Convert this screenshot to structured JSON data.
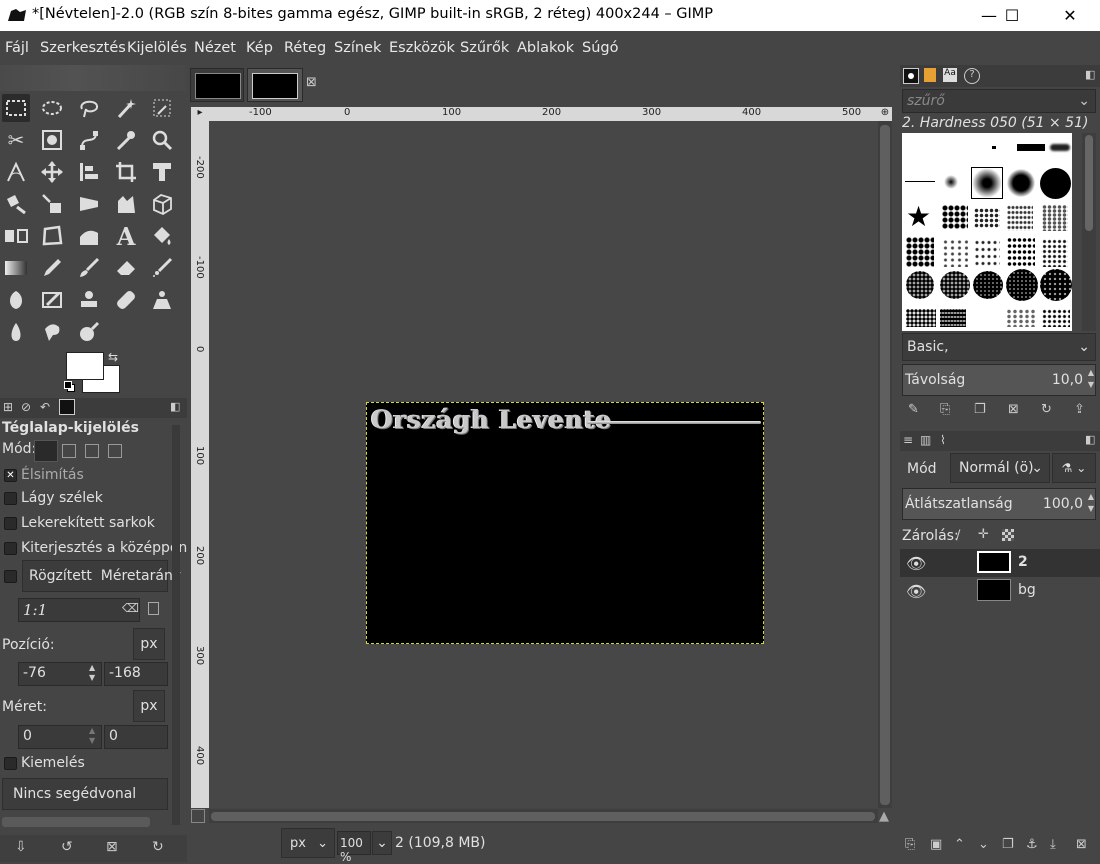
{
  "window": {
    "title": "*[Névtelen]-2.0 (RGB szín 8-bites gamma egész, GIMP built-in sRGB, 2 réteg) 400x244 – GIMP",
    "minimize": "—",
    "maximize": "☐",
    "close": "✕"
  },
  "menu": [
    "Fájl",
    "Szerkesztés",
    "Kijelölés",
    "Nézet",
    "Kép",
    "Réteg",
    "Színek",
    "Eszközök",
    "Szűrők",
    "Ablakok",
    "Súgó"
  ],
  "tool_options": {
    "title": "Téglalap-kijelölés",
    "mode_label": "Mód:",
    "antialias": "Élsimítás",
    "feather": "Lágy szélek",
    "rounded": "Lekerekített sarkok",
    "expand_center": "Kiterjesztés a középpont",
    "fixed_label": "Rögzített",
    "fixed_option": "Méretarány",
    "ratio_value": "1:1",
    "position_label": "Pozíció:",
    "position_unit": "px",
    "pos_x": "-76",
    "pos_y": "-168",
    "size_label": "Méret:",
    "size_unit": "px",
    "size_w": "0",
    "size_h": "0",
    "highlight": "Kiemelés",
    "guides": "Nincs segédvonal"
  },
  "ruler": {
    "h_ticks": [
      "-100",
      "0",
      "100",
      "200",
      "300",
      "400",
      "500"
    ],
    "v_ticks": [
      "-200",
      "-100",
      "0",
      "100",
      "200",
      "300",
      "400"
    ]
  },
  "canvas": {
    "text": "Országh Levente"
  },
  "status": {
    "unit": "px",
    "zoom": "100 %",
    "info": "2 (109,8 MB)"
  },
  "brushes": {
    "filter_placeholder": "szűrő",
    "current": "2. Hardness 050 (51 × 51)",
    "tag": "Basic,",
    "spacing_label": "Távolság",
    "spacing_value": "10,0"
  },
  "layers": {
    "mode_label": "Mód",
    "mode_value": "Normál (ö)",
    "opacity_label": "Átlátszatlanság",
    "opacity_value": "100,0",
    "lock_label": "Zárolás:",
    "items": [
      {
        "name": "2"
      },
      {
        "name": "bg"
      }
    ]
  }
}
